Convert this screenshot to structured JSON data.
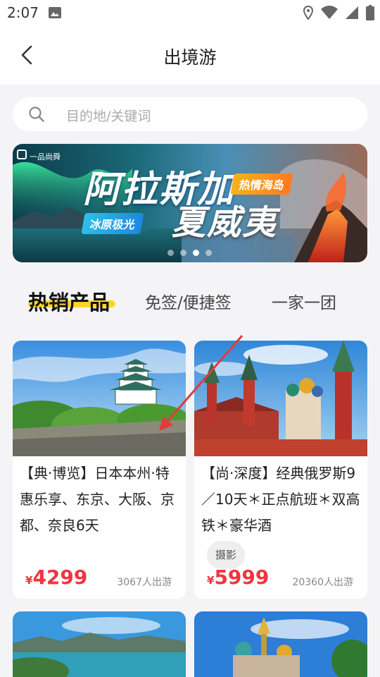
{
  "status_bar": {
    "time": "2:07"
  },
  "header": {
    "title": "出境游"
  },
  "search": {
    "placeholder": "目的地/关键词"
  },
  "banner": {
    "brand": "一品尚舜",
    "title_line1": "阿拉斯加",
    "title_line2": "夏威夷",
    "tag_hot": "热情海岛",
    "tag_cold": "冰原极光",
    "dot_count": 4,
    "active_dot": 2
  },
  "tabs": [
    {
      "label": "热销产品",
      "active": true
    },
    {
      "label": "免签/便捷签",
      "active": false
    },
    {
      "label": "一家一团",
      "active": false
    }
  ],
  "products": [
    {
      "title": "【典·博览】日本本州·特惠乐享、东京、大阪、京都、奈良6天",
      "tag": "",
      "price_symbol": "¥",
      "price": "4299",
      "sold": "3067人出游",
      "image": "osaka-castle-photo"
    },
    {
      "title": "【尚·深度】经典俄罗斯9／10天＊正点航班＊双高铁＊豪华酒",
      "tag": "摄影",
      "price_symbol": "¥",
      "price": "5999",
      "sold": "20360人出游",
      "image": "moscow-kremlin-photo"
    }
  ],
  "colors": {
    "price": "#f0353f",
    "tab_highlight": "#ffd426",
    "annotation_arrow": "#e23b3b"
  }
}
